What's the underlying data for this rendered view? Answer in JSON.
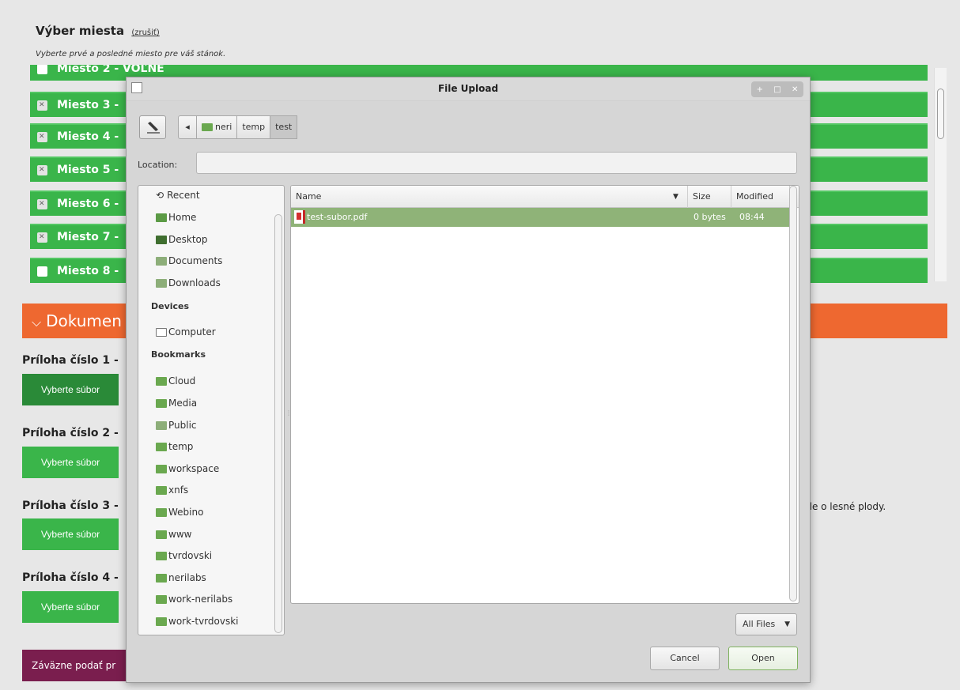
{
  "page": {
    "title": "Výber miesta",
    "cancel_link": "(zrušiť)",
    "subtitle": "Vyberte prvé a posledné miesto pre váš stánok.",
    "spots": [
      {
        "label": "Miesto 2 - VOĽNÉ",
        "checked": false
      },
      {
        "label": "Miesto 3 -",
        "checked": true
      },
      {
        "label": "Miesto 4 -",
        "checked": true
      },
      {
        "label": "Miesto 5 -",
        "checked": true
      },
      {
        "label": "Miesto 6 -",
        "checked": true
      },
      {
        "label": "Miesto 7 -",
        "checked": true
      },
      {
        "label": "Miesto 8 -",
        "checked": false
      }
    ],
    "documents_section": "Dokumen",
    "attachments": [
      {
        "label": "Príloha číslo 1 - ",
        "button": "Vyberte súbor"
      },
      {
        "label": "Príloha číslo 2 - ",
        "button": "Vyberte súbor"
      },
      {
        "label": "Príloha číslo 3 - ",
        "button": "Vyberte súbor"
      },
      {
        "label": "Príloha číslo 4 - ",
        "button": "Vyberte súbor"
      }
    ],
    "side_note": "ide o lesné plody.",
    "submit_button": "Záväzne podať pr",
    "colors": {
      "spot_green": "#3ab54a",
      "section_orange": "#ee6830",
      "submit_purple": "#7a1e4e"
    }
  },
  "dialog": {
    "title": "File Upload",
    "wm_controls": [
      "+",
      "□",
      "✕"
    ],
    "path_segments": [
      "neri",
      "temp",
      "test"
    ],
    "location_label": "Location:",
    "location_value": "",
    "places": [
      {
        "label": "Recent",
        "icon": "recent-icon"
      },
      {
        "label": "Home",
        "icon": "home-folder-icon"
      },
      {
        "label": "Desktop",
        "icon": "desktop-icon"
      },
      {
        "label": "Documents",
        "icon": "documents-folder-icon"
      },
      {
        "label": "Downloads",
        "icon": "downloads-folder-icon"
      }
    ],
    "devices_heading": "Devices",
    "devices": [
      {
        "label": "Computer",
        "icon": "computer-icon"
      }
    ],
    "bookmarks_heading": "Bookmarks",
    "bookmarks": [
      "Cloud",
      "Media",
      "Public",
      "temp",
      "workspace",
      "xnfs",
      "Webino",
      "www",
      "tvrdovski",
      "nerilabs",
      "work-nerilabs",
      "work-tvrdovski"
    ],
    "columns": {
      "name": "Name",
      "size": "Size",
      "modified": "Modified"
    },
    "files": [
      {
        "name": "test-subor.pdf",
        "size": "0 bytes",
        "modified": "08:44",
        "icon": "pdf-file-icon"
      }
    ],
    "filter": "All Files",
    "cancel_button": "Cancel",
    "open_button": "Open",
    "colors": {
      "selection": "#8fb378",
      "folder": "#6aa84f"
    }
  }
}
